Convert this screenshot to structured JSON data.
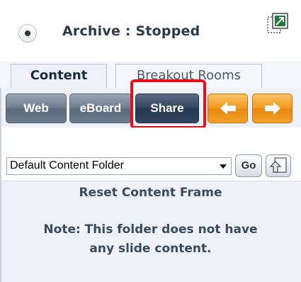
{
  "archive": {
    "status_label": "Archive : Stopped"
  },
  "tabs": [
    {
      "label": "Content",
      "active": true
    },
    {
      "label": "Breakout Rooms",
      "active": false
    }
  ],
  "toolbar": {
    "web_label": "Web",
    "eboard_label": "eBoard",
    "share_label": "Share",
    "back_icon": "arrow-left-icon",
    "forward_icon": "arrow-right-icon",
    "highlighted": "Share"
  },
  "folder": {
    "selected": "Default Content Folder",
    "go_label": "Go",
    "upload_icon": "upload-icon"
  },
  "reset_label": "Reset Content Frame",
  "note_lines": [
    "Note: This folder does not have",
    "any slide content."
  ],
  "colors": {
    "accent_orange": "#f29a1e",
    "highlight_red": "#e8101a",
    "button_gray": "#6f7d90",
    "button_dark": "#2b3f58"
  }
}
